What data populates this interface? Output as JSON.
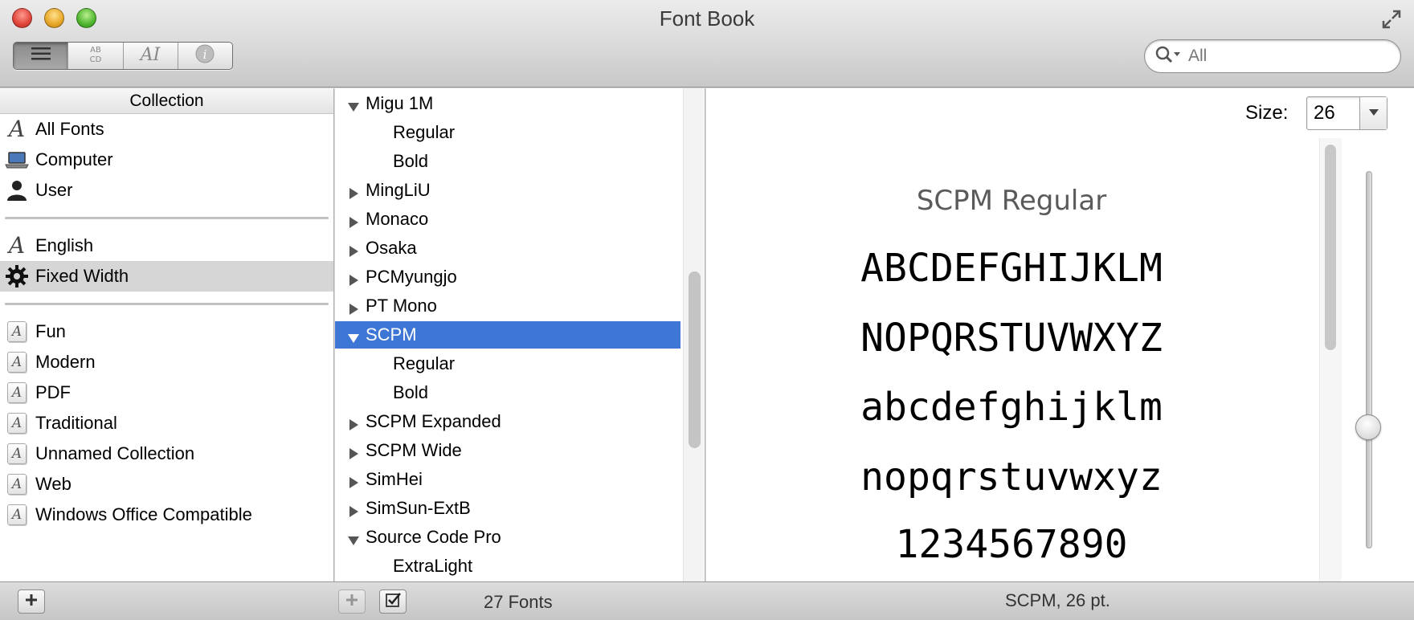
{
  "window": {
    "title": "Font Book"
  },
  "toolbar": {
    "view_segments": [
      {
        "name": "sample-view",
        "icon": "list-lines-icon",
        "active": true
      },
      {
        "name": "repertoire-view",
        "icon": "abcd-grid-icon",
        "text": "AB CD",
        "active": false
      },
      {
        "name": "custom-view",
        "icon": "ai-glyph-icon",
        "text": "AI",
        "active": false
      },
      {
        "name": "info-view",
        "icon": "info-icon",
        "text": "i",
        "active": false
      }
    ],
    "search": {
      "placeholder": "All",
      "icon": "search-icon"
    }
  },
  "collections": {
    "header": "Collection",
    "groups": [
      [
        {
          "label": "All Fonts",
          "icon": "script-a-icon"
        },
        {
          "label": "Computer",
          "icon": "laptop-icon"
        },
        {
          "label": "User",
          "icon": "user-silhouette-icon"
        }
      ],
      [
        {
          "label": "English",
          "icon": "script-a-icon"
        },
        {
          "label": "Fixed Width",
          "icon": "gear-icon",
          "selected": true
        }
      ],
      [
        {
          "label": "Fun",
          "icon": "boxed-a-icon"
        },
        {
          "label": "Modern",
          "icon": "boxed-a-icon"
        },
        {
          "label": "PDF",
          "icon": "boxed-a-icon"
        },
        {
          "label": "Traditional",
          "icon": "boxed-a-icon"
        },
        {
          "label": "Unnamed Collection",
          "icon": "boxed-a-icon"
        },
        {
          "label": "Web",
          "icon": "boxed-a-icon"
        },
        {
          "label": "Windows Office Compatible",
          "icon": "boxed-a-icon"
        }
      ]
    ]
  },
  "fonts": {
    "rows": [
      {
        "label": "Migu 1M",
        "kind": "family",
        "expanded": true
      },
      {
        "label": "Regular",
        "kind": "face"
      },
      {
        "label": "Bold",
        "kind": "face"
      },
      {
        "label": "MingLiU",
        "kind": "family",
        "expanded": false
      },
      {
        "label": "Monaco",
        "kind": "family",
        "expanded": false
      },
      {
        "label": "Osaka",
        "kind": "family",
        "expanded": false
      },
      {
        "label": "PCMyungjo",
        "kind": "family",
        "expanded": false
      },
      {
        "label": "PT Mono",
        "kind": "family",
        "expanded": false
      },
      {
        "label": "SCPM",
        "kind": "family",
        "expanded": true,
        "selected": true
      },
      {
        "label": "Regular",
        "kind": "face"
      },
      {
        "label": "Bold",
        "kind": "face"
      },
      {
        "label": "SCPM Expanded",
        "kind": "family",
        "expanded": false
      },
      {
        "label": "SCPM Wide",
        "kind": "family",
        "expanded": false
      },
      {
        "label": "SimHei",
        "kind": "family",
        "expanded": false
      },
      {
        "label": "SimSun-ExtB",
        "kind": "family",
        "expanded": false
      },
      {
        "label": "Source Code Pro",
        "kind": "family",
        "expanded": true
      },
      {
        "label": "ExtraLight",
        "kind": "face"
      }
    ],
    "count_label": "27 Fonts"
  },
  "preview": {
    "size_label": "Size:",
    "size_value": "26",
    "heading": "SCPM Regular",
    "lines": [
      "ABCDEFGHIJKLM",
      "NOPQRSTUVWXYZ",
      "abcdefghijklm",
      "nopqrstuvwxyz",
      "1234567890"
    ],
    "status": "SCPM, 26 pt."
  },
  "colors": {
    "selection_blue": "#3d76d4",
    "collection_selection": "#d6d6d6",
    "close": "#e0443a",
    "minimize": "#e6a628",
    "zoom": "#4fb52e"
  }
}
